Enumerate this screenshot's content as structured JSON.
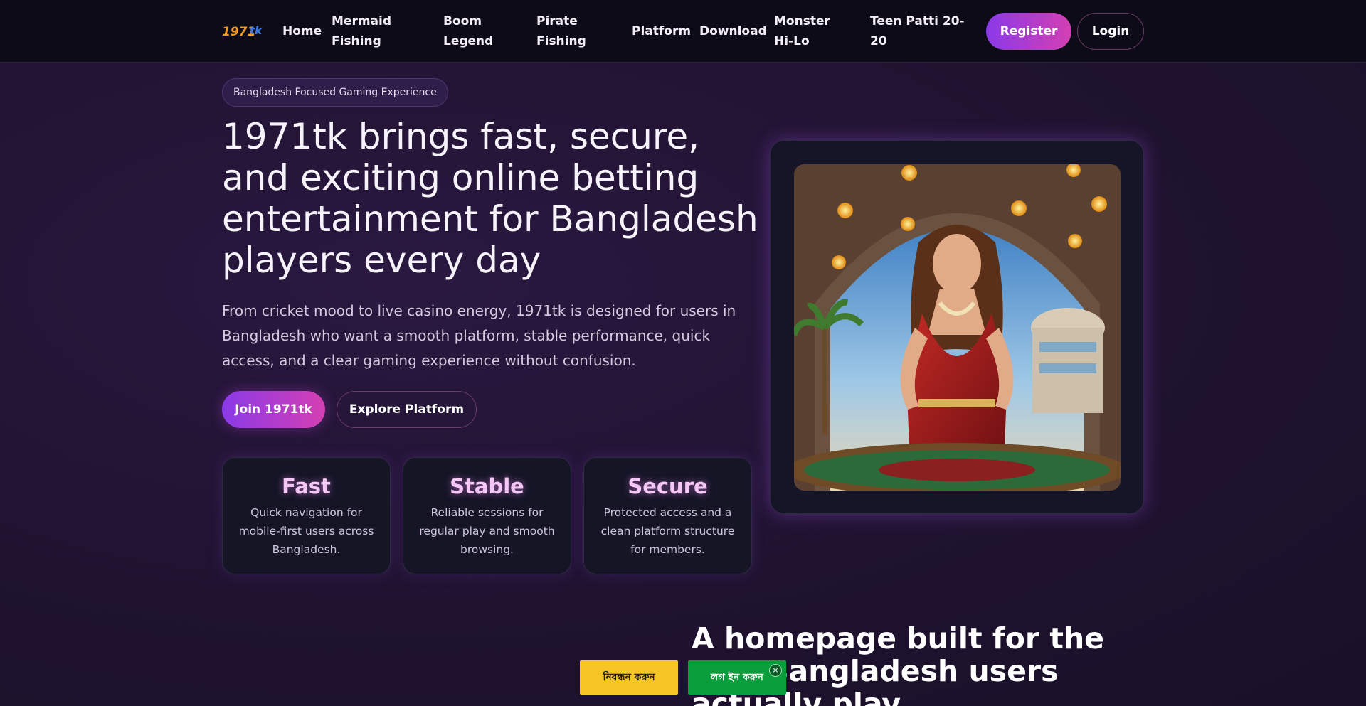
{
  "nav": {
    "logo_text": "1971tk",
    "items": [
      "Home",
      "Mermaid Fishing",
      "Boom Legend",
      "Pirate Fishing",
      "Platform",
      "Download",
      "Monster Hi-Lo",
      "Teen Patti 20-20"
    ],
    "register_label": "Register",
    "login_label": "Login"
  },
  "hero": {
    "badge": "Bangladesh Focused Gaming Experience",
    "title": "1971tk brings fast, secure, and exciting online betting entertainment for Bangladesh players every day",
    "description": "From cricket mood to live casino energy, 1971tk is designed for users in Bangladesh who want a smooth platform, stable performance, quick access, and a clear gaming experience without confusion.",
    "join_label": "Join 1971tk",
    "explore_label": "Explore Platform",
    "features": [
      {
        "title": "Fast",
        "text": "Quick navigation for mobile-first users across Bangladesh."
      },
      {
        "title": "Stable",
        "text": "Reliable sessions for regular play and smooth browsing."
      },
      {
        "title": "Secure",
        "text": "Protected access and a clean platform structure for members."
      }
    ]
  },
  "section2": {
    "title": "A homepage built for the way Bangladesh users actually play"
  },
  "sticky": {
    "register_label": "নিবন্ধন করুন",
    "login_label": "লগ ইন করুন",
    "close_symbol": "×"
  },
  "colors": {
    "accent_gradient_start": "#8a3ae8",
    "accent_gradient_end": "#d43fb2",
    "sticky_register": "#f6c526",
    "sticky_login": "#0a9d3c"
  }
}
